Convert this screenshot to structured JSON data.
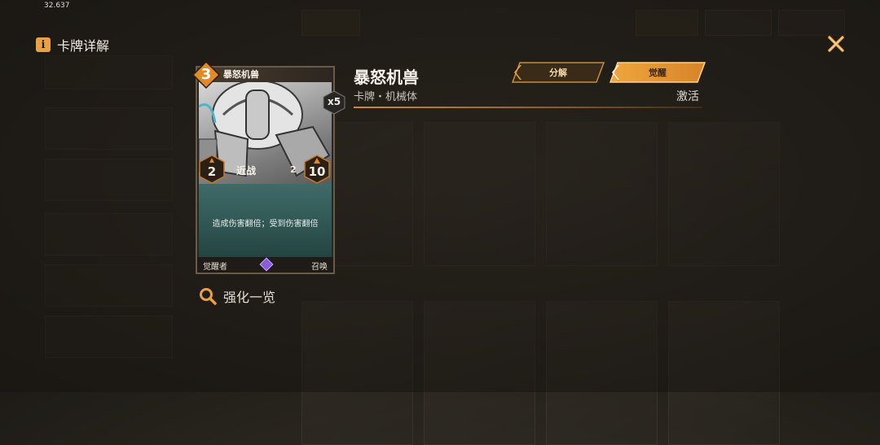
{
  "status": {
    "time": "32.637"
  },
  "header": {
    "title": "卡牌详解",
    "info_icon_glyph": "i"
  },
  "card": {
    "name": "暴怒机兽",
    "cost": "3",
    "count": "x5",
    "attack": "2",
    "health": "10",
    "type_label": "近战",
    "small_stat": "2",
    "description": "造成伤害翻倍；受到伤害翻倍",
    "footer_left": "觉醒者",
    "footer_right": "召唤",
    "gem_color": "#8a5cd8"
  },
  "enhance": {
    "label": "强化一览",
    "icon": "search-icon"
  },
  "info": {
    "title": "暴怒机兽",
    "subtitle": "卡牌・机械体",
    "status": "激活",
    "accent": "#d08a2e"
  },
  "buttons": {
    "decompose": "分解",
    "awaken": "觉醒"
  }
}
